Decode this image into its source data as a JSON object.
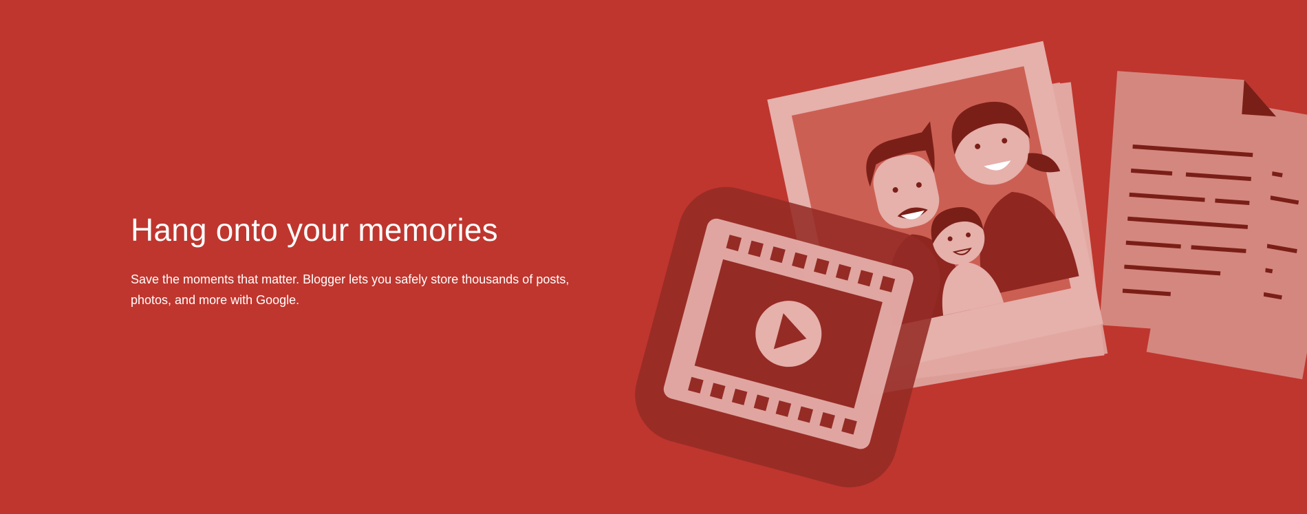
{
  "hero": {
    "headline": "Hang onto your memories",
    "body": "Save the moments that matter. Blogger lets you safely store thousands of posts, photos, and more with Google."
  },
  "colors": {
    "background": "#bf362e",
    "card_light": "#e6b0ab",
    "card_mid": "#d4877f",
    "photo_inner": "#cc5f53",
    "dark_accent": "#7a1f18",
    "video_tile": "#952b25"
  },
  "icons": {
    "photo": "family-photo-icon",
    "document": "document-icon",
    "video": "video-icon",
    "play": "play-icon"
  }
}
